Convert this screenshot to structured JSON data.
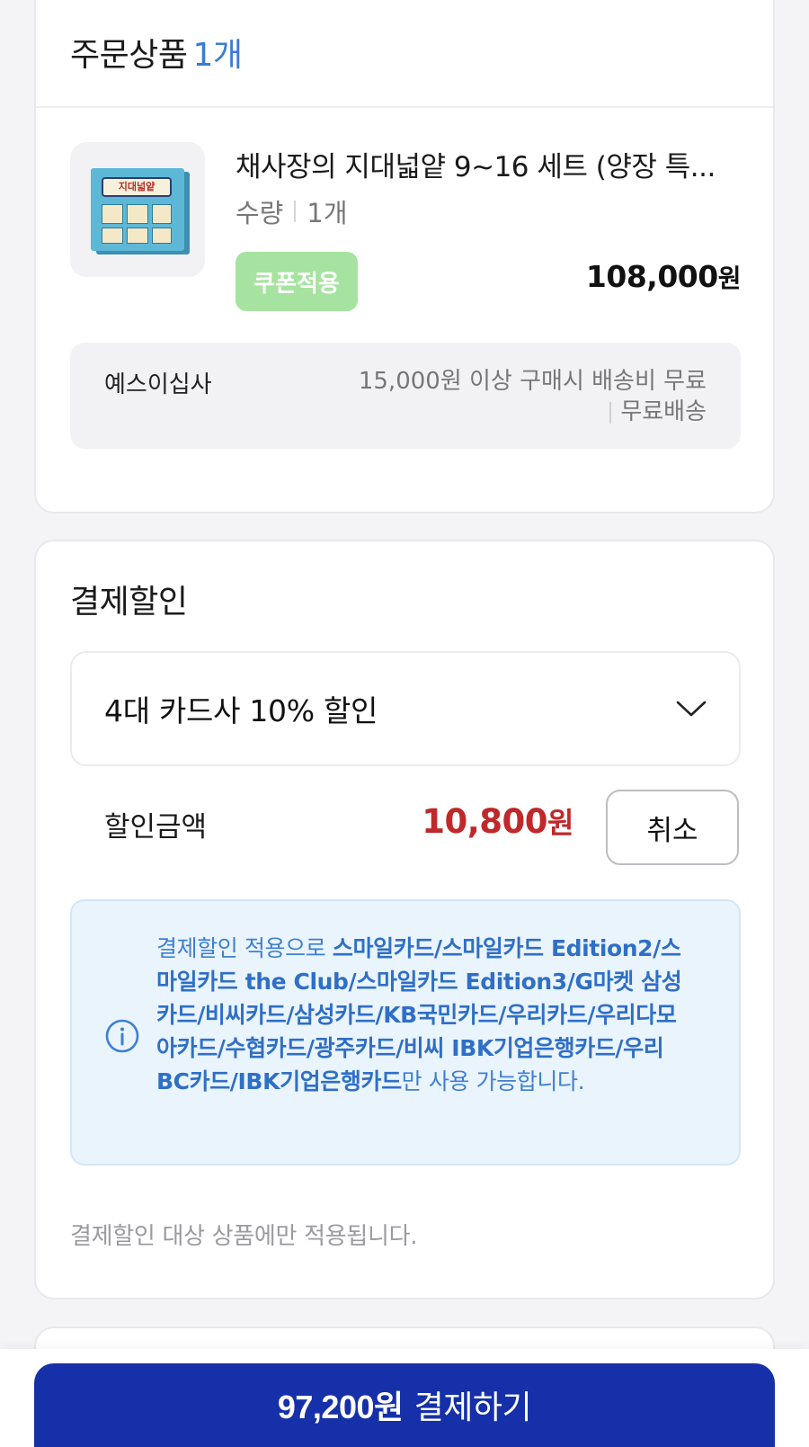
{
  "order": {
    "title": "주문상품",
    "count": "1개",
    "product": {
      "name": "채사장의 지대넓얕 9~16 세트 (양장 특...",
      "quantity_label": "수량",
      "quantity_value": "1개",
      "thumbnail_text": "지대넓얕",
      "coupon_button": "쿠폰적용",
      "price": "108,000",
      "price_unit": "원"
    },
    "shipping": {
      "seller": "예스이십사",
      "condition": "15,000원 이상 구매시 배송비 무료",
      "fee": "무료배송"
    }
  },
  "discount": {
    "title": "결제할인",
    "selected_option": "4대 카드사 10% 할인",
    "amount_label": "할인금액",
    "amount_value": "10,800",
    "amount_unit": "원",
    "cancel_button": "취소",
    "notice_prefix": "결제할인 적용으로 ",
    "notice_cards": "스마일카드/스마일카드 Edition2/스마일카드 the Club/스마일카드 Edition3/G마켓 삼성카드/비씨카드/삼성카드/KB국민카드/우리카드/우리다모아카드/수협카드/광주카드/비씨 IBK기업은행카드/우리BC카드/IBK기업은행카드",
    "notice_suffix": "만 사용 가능합니다.",
    "footer_note": "결제할인 대상 상품에만 적용됩니다."
  },
  "pay_button": {
    "amount": "97,200원",
    "label": "결제하기"
  },
  "colors": {
    "accent_blue": "#3a7bd5",
    "discount_red": "#c0282a",
    "pay_button": "#1530a8",
    "coupon_green": "#a6e3a0"
  }
}
